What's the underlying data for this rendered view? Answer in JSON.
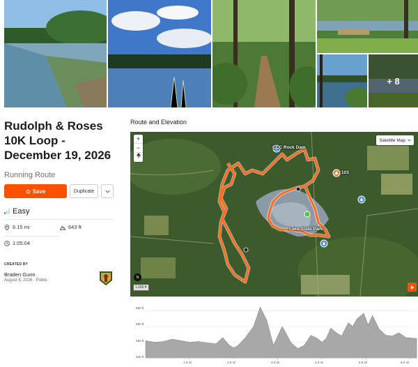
{
  "gallery": {
    "more_label": "+ 8"
  },
  "route": {
    "title": "Rudolph & Roses 10K Loop - December 19, 2026",
    "type_label": "Running Route"
  },
  "actions": {
    "save_label": "Save",
    "duplicate_label": "Duplicate",
    "more_icon": "chevron-down-icon"
  },
  "difficulty": {
    "label": "Easy",
    "color": "#4caf50"
  },
  "stats": {
    "distance": "6.15 mi",
    "elevation_gain": "643 ft",
    "est_time": "1:05:04"
  },
  "creator": {
    "heading": "CREATED BY",
    "name": "Braden Gunn",
    "meta": "August 5, 2026 · Public"
  },
  "map": {
    "heading": "Route and Elevation",
    "map_type": "Satellite Map",
    "zoom_in": "+",
    "zoom_out": "−",
    "scale_label": "1,000 ft",
    "poi_dam": "CCC Rock Dam",
    "poi_park": "Lake State Park",
    "poi_marker": "103",
    "route_color": "#fc6b1e",
    "accent_color": "#fc5200"
  },
  "elevation": {
    "y_ticks": [
      "550 ft",
      "500 ft",
      "450 ft",
      "400 ft"
    ],
    "x_ticks": [
      "1.0 mi",
      "2.0 mi",
      "3.0 mi",
      "4.0 mi",
      "5.0 mi",
      "6.0 mi"
    ]
  },
  "chart_data": {
    "type": "area",
    "title": "",
    "xlabel": "",
    "ylabel": "",
    "xlim": [
      0,
      6.15
    ],
    "ylim": [
      400,
      560
    ],
    "x": [
      0,
      0.2,
      0.4,
      0.6,
      0.8,
      1.0,
      1.2,
      1.4,
      1.6,
      1.75,
      1.9,
      2.0,
      2.1,
      2.25,
      2.45,
      2.6,
      2.75,
      2.9,
      3.0,
      3.1,
      3.2,
      3.3,
      3.45,
      3.6,
      3.75,
      3.9,
      4.0,
      4.1,
      4.2,
      4.35,
      4.45,
      4.6,
      4.7,
      4.8,
      4.95,
      5.05,
      5.15,
      5.3,
      5.45,
      5.6,
      5.75,
      5.9,
      6.15
    ],
    "y": [
      455,
      450,
      452,
      460,
      455,
      450,
      452,
      448,
      445,
      465,
      440,
      432,
      440,
      462,
      500,
      562,
      520,
      440,
      470,
      500,
      475,
      448,
      430,
      440,
      472,
      462,
      450,
      462,
      495,
      478,
      470,
      512,
      500,
      525,
      542,
      505,
      535,
      492,
      472,
      470,
      480,
      465,
      462
    ]
  }
}
